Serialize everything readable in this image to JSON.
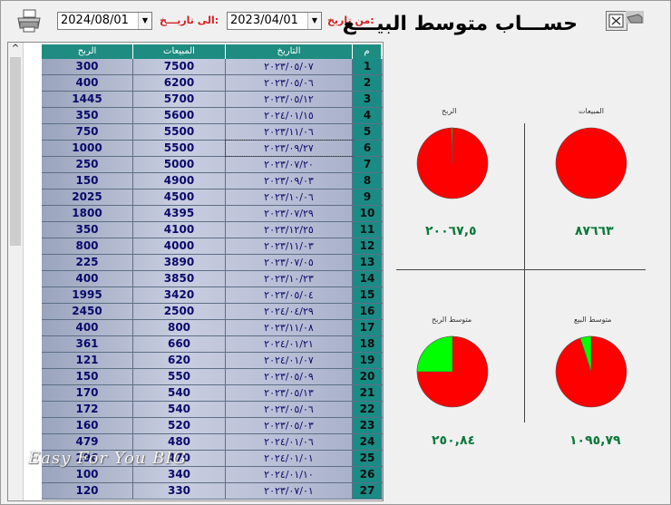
{
  "window": {
    "title": "حســـاب متوسط البيـــع"
  },
  "filters": {
    "from_label": "من تاريخ:",
    "from_value": "2023/04/01",
    "to_label": "الى تاريـــخ:",
    "to_value": "2024/08/01"
  },
  "icons": {
    "print": "printer-icon",
    "close": "close-icon",
    "dropdown": "chevron-down-icon",
    "scroll_up": "scroll-up-arrow-icon"
  },
  "colors": {
    "header_bg": "#1e8c80",
    "title_red": "#d62020",
    "pie_red": "#ff0000",
    "pie_green": "#00ff00",
    "value_green": "#0d7a3b"
  },
  "table": {
    "columns": [
      "الربح",
      "المبيعات",
      "التاريخ",
      "م"
    ],
    "rows": [
      {
        "profit": "300",
        "sales": "7500",
        "date": "٢٠٢٣/٠٥/٠٧",
        "n": "1"
      },
      {
        "profit": "400",
        "sales": "6200",
        "date": "٢٠٢٣/٠٥/٠٦",
        "n": "2"
      },
      {
        "profit": "1445",
        "sales": "5700",
        "date": "٢٠٢٣/٠٥/١٢",
        "n": "3"
      },
      {
        "profit": "350",
        "sales": "5600",
        "date": "٢٠٢٤/٠١/١٥",
        "n": "4"
      },
      {
        "profit": "750",
        "sales": "5500",
        "date": "٢٠٢٣/١١/٠٦",
        "n": "5"
      },
      {
        "profit": "1000",
        "sales": "5500",
        "date": "٢٠٢٣/٠٩/٢٧",
        "n": "6"
      },
      {
        "profit": "250",
        "sales": "5000",
        "date": "٢٠٢٣/٠٧/٢٠",
        "n": "7"
      },
      {
        "profit": "150",
        "sales": "4900",
        "date": "٢٠٢٣/٠٩/٠٣",
        "n": "8"
      },
      {
        "profit": "2025",
        "sales": "4500",
        "date": "٢٠٢٣/١٠/٠٦",
        "n": "9"
      },
      {
        "profit": "1800",
        "sales": "4395",
        "date": "٢٠٢٣/٠٧/٢٩",
        "n": "10"
      },
      {
        "profit": "350",
        "sales": "4100",
        "date": "٢٠٢٣/١٢/٢٥",
        "n": "11"
      },
      {
        "profit": "800",
        "sales": "4000",
        "date": "٢٠٢٣/١١/٠٣",
        "n": "12"
      },
      {
        "profit": "225",
        "sales": "3890",
        "date": "٢٠٢٣/٠٧/٠٥",
        "n": "13"
      },
      {
        "profit": "400",
        "sales": "3850",
        "date": "٢٠٢٣/١٠/٢٣",
        "n": "14"
      },
      {
        "profit": "1995",
        "sales": "3420",
        "date": "٢٠٢٣/٠٥/٠٤",
        "n": "15"
      },
      {
        "profit": "2450",
        "sales": "2500",
        "date": "٢٠٢٤/٠٤/٢٩",
        "n": "16"
      },
      {
        "profit": "400",
        "sales": "800",
        "date": "٢٠٢٣/١١/٠٨",
        "n": "17"
      },
      {
        "profit": "361",
        "sales": "660",
        "date": "٢٠٢٤/٠١/٢١",
        "n": "18"
      },
      {
        "profit": "121",
        "sales": "620",
        "date": "٢٠٢٤/٠١/٠٧",
        "n": "19"
      },
      {
        "profit": "150",
        "sales": "550",
        "date": "٢٠٢٣/٠٥/٠٩",
        "n": "20"
      },
      {
        "profit": "170",
        "sales": "540",
        "date": "٢٠٢٣/٠٥/١٣",
        "n": "21"
      },
      {
        "profit": "172",
        "sales": "540",
        "date": "٢٠٢٣/٠٥/٠٦",
        "n": "22"
      },
      {
        "profit": "160",
        "sales": "520",
        "date": "٢٠٢٣/٠٥/٠٣",
        "n": "23"
      },
      {
        "profit": "479",
        "sales": "480",
        "date": "٢٠٢٤/٠١/٠٦",
        "n": "24"
      },
      {
        "profit": "296",
        "sales": "470",
        "date": "٢٠٢٤/٠١/٠١",
        "n": "25"
      },
      {
        "profit": "100",
        "sales": "340",
        "date": "٢٠٢٤/٠١/١٠",
        "n": "26"
      },
      {
        "profit": "120",
        "sales": "330",
        "date": "٢٠٢٣/٠٧/٠١",
        "n": "27"
      }
    ]
  },
  "watermark": "Easy For You BIG",
  "charts": {
    "profit": {
      "label": "الربح",
      "value": "٢٠٠٦٧,٥",
      "green_fraction": 0.005
    },
    "sales": {
      "label": "المبيعات",
      "value": "٨٧٦٦٣",
      "green_fraction": 0.0
    },
    "avg_profit": {
      "label": "متوسط الربح",
      "value": "٢٥٠,٨٤",
      "green_fraction": 0.25
    },
    "avg_sale": {
      "label": "متوسط البيع",
      "value": "١٠٩٥,٧٩",
      "green_fraction": 0.05
    }
  }
}
